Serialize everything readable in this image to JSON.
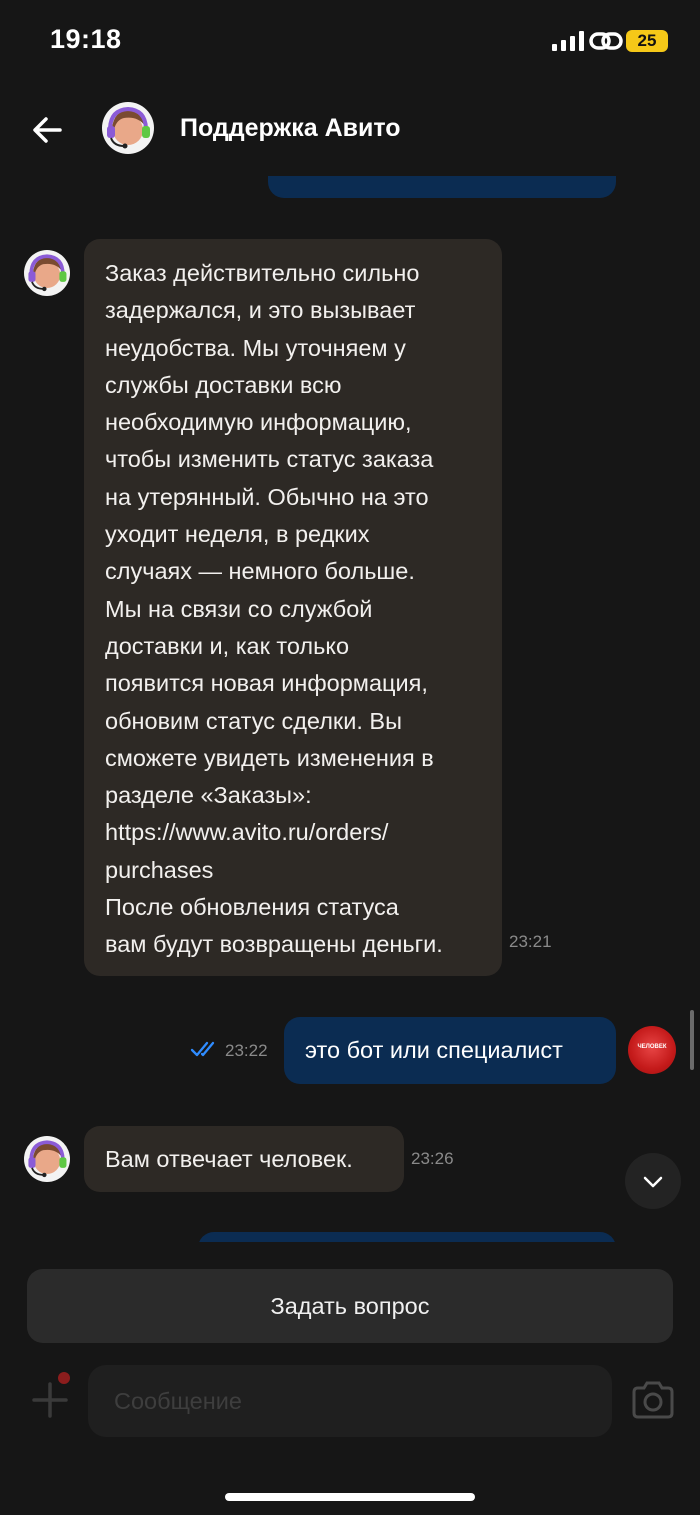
{
  "status_bar": {
    "time": "19:18",
    "battery": "25"
  },
  "header": {
    "title": "Поддержка Авито"
  },
  "messages": [
    {
      "direction": "in",
      "text": "Заказ действительно сильно\nзадержался, и это вызывает\nнеудобства. Мы уточняем у\nслужбы доставки всю\nнеобходимую информацию,\nчтобы изменить статус заказа\nна утерянный. Обычно на это\nуходит неделя, в редких\nслучаях — немного больше.\nМы на связи со службой\nдоставки и, как только\nпоявится новая информация,\nобновим статус сделки. Вы\nсможете увидеть изменения в\nразделе «Заказы»:\nhttps://www.avito.ru/orders/\npurchases\nПосле обновления статуса\nвам будут возвращены деньги.",
      "time": "23:21"
    },
    {
      "direction": "out",
      "text": "это бот или специалист",
      "time": "23:22",
      "status": "read"
    },
    {
      "direction": "in",
      "text": "Вам отвечает человек.",
      "time": "23:26"
    }
  ],
  "user_avatar_label": "ЧЕЛОВЕК",
  "ask_button": {
    "label": "Задать вопрос"
  },
  "composer": {
    "placeholder": "Сообщение"
  },
  "colors": {
    "background": "#161616",
    "incoming": "#2d2925",
    "outgoing": "#0b2c52",
    "ticks": "#2f8cff"
  }
}
